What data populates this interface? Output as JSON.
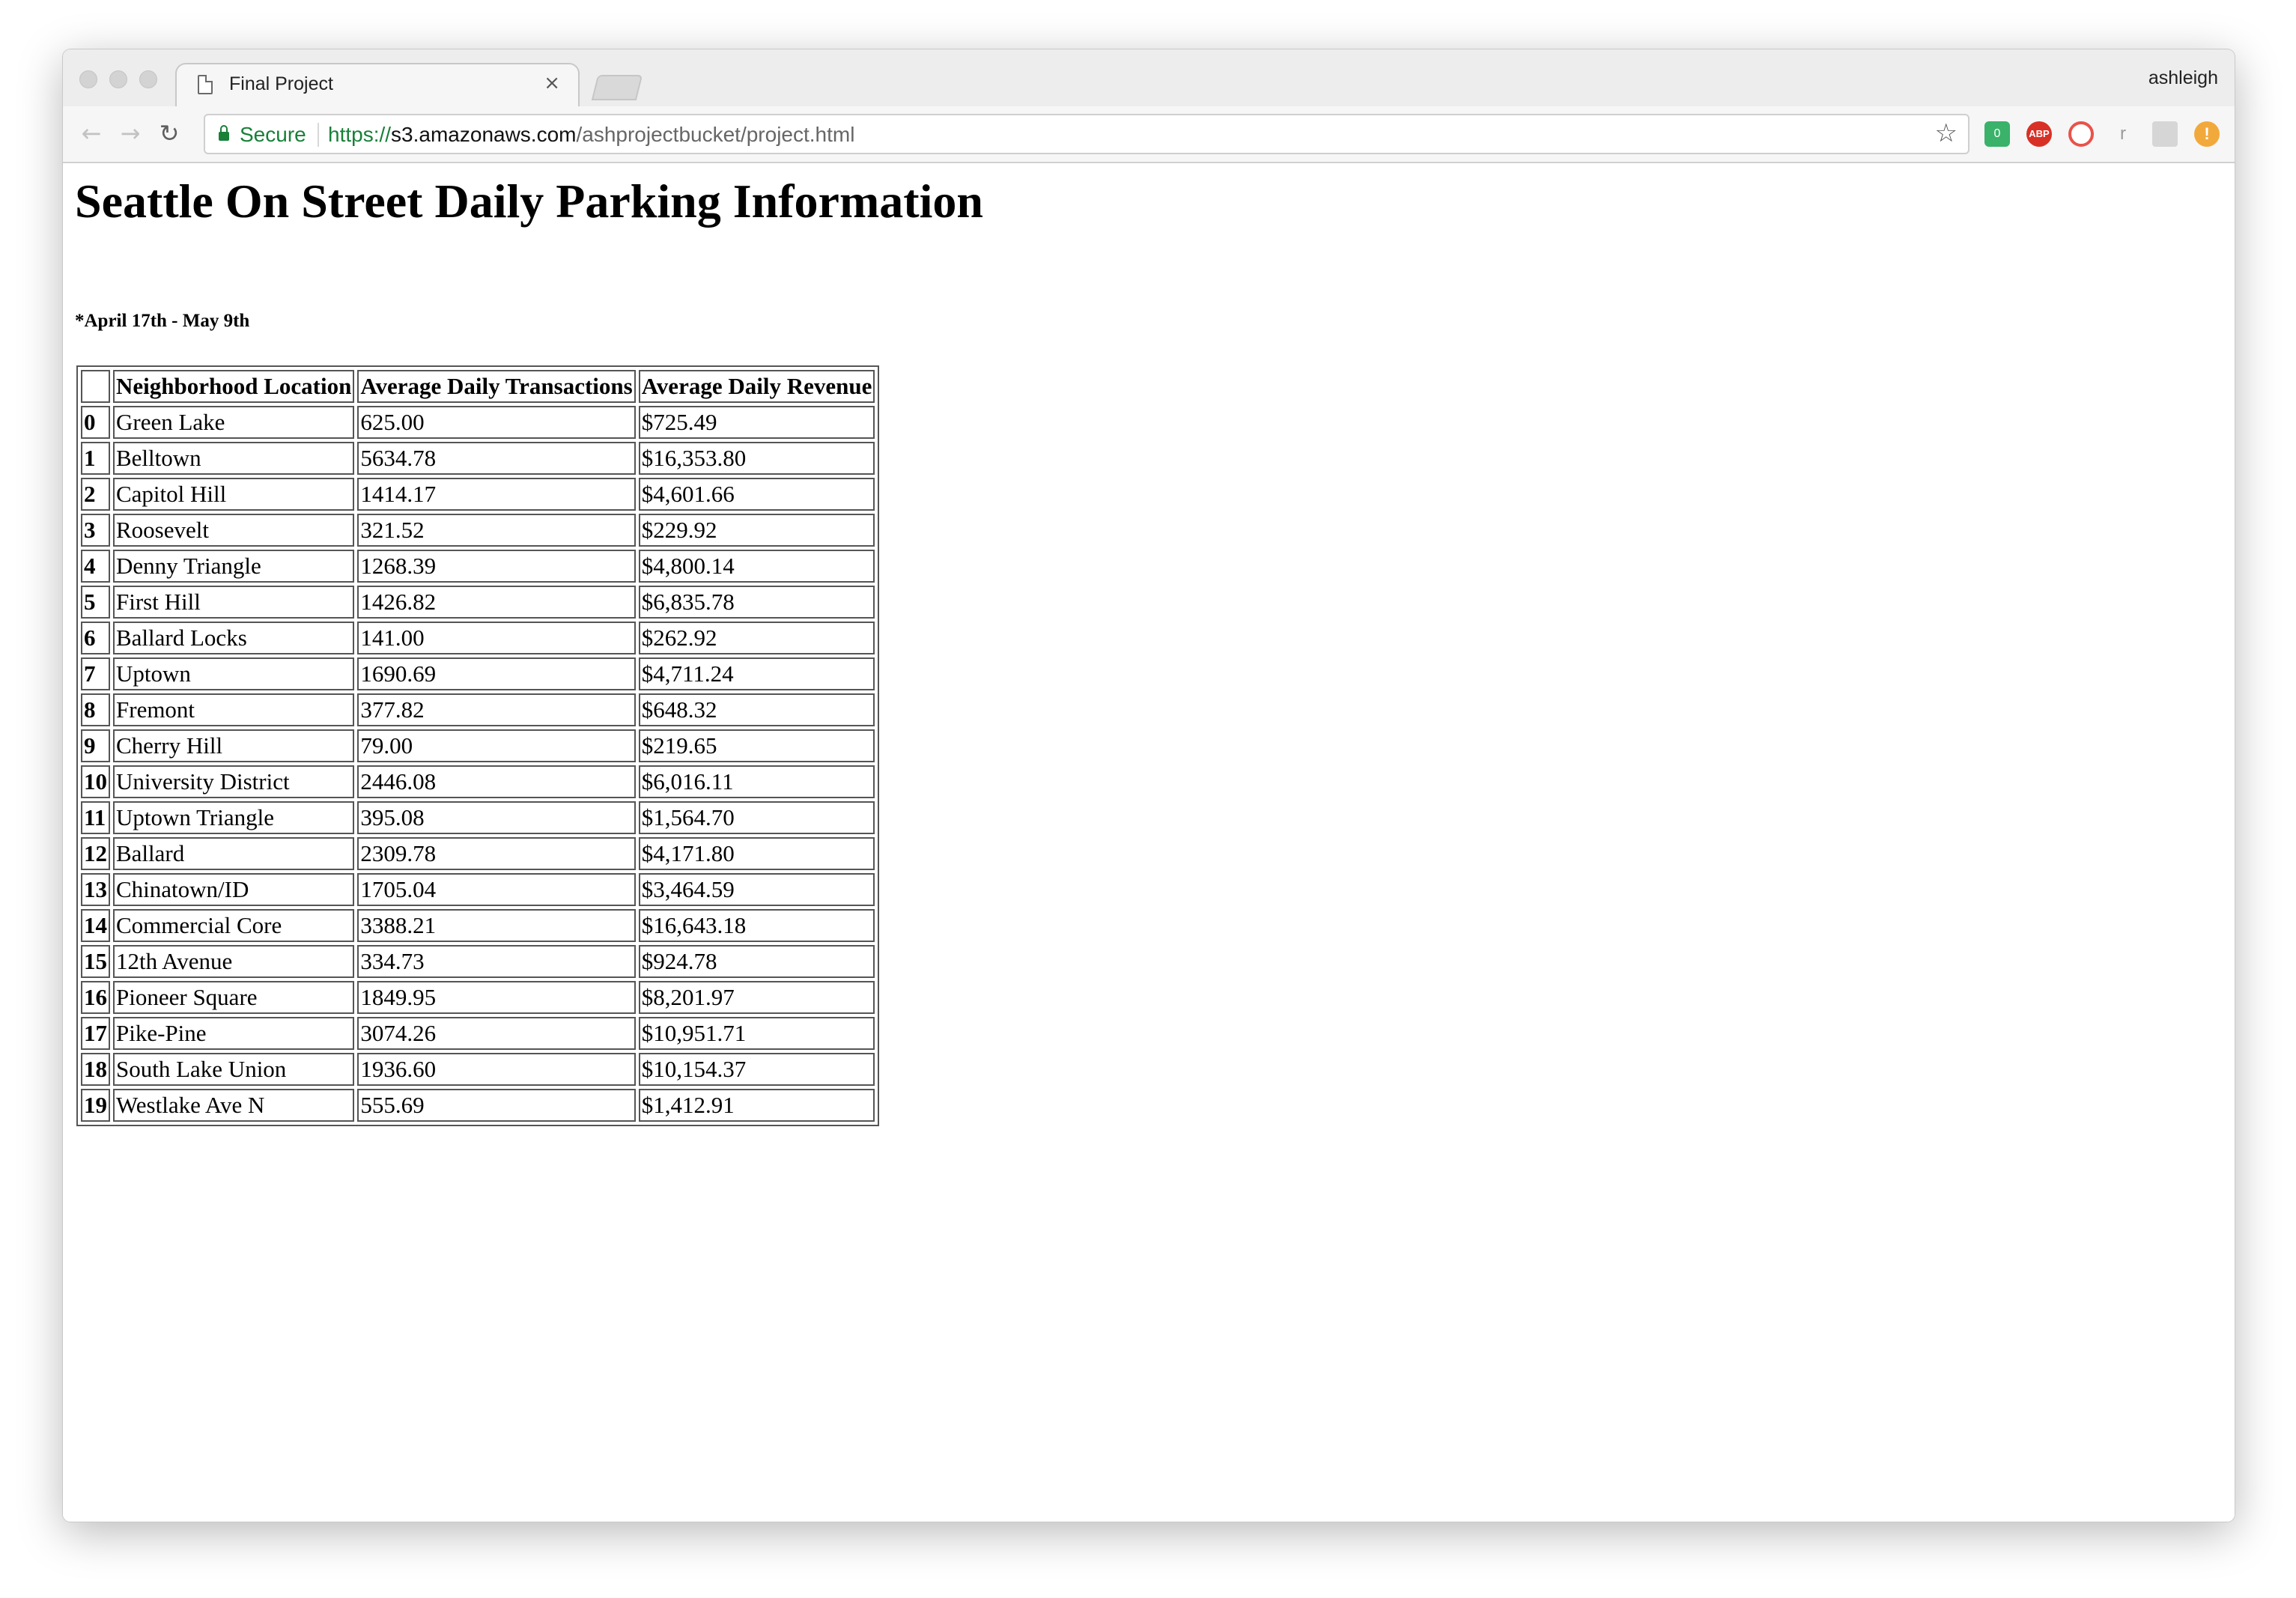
{
  "browser": {
    "tab_title": "Final Project",
    "tab_close": "×",
    "profile_name": "ashleigh",
    "secure_label": "Secure",
    "url_scheme": "https://",
    "url_host": "s3.amazonaws.com",
    "url_path": "/ashprojectbucket/project.html",
    "nav": {
      "back": "←",
      "forward": "→",
      "reload": "↻"
    },
    "star": "☆",
    "extensions": [
      {
        "name": "tampermonkey",
        "label": "0"
      },
      {
        "name": "adblock-plus",
        "label": "ABP"
      },
      {
        "name": "privacy",
        "label": ""
      },
      {
        "name": "r-extension",
        "label": "r"
      },
      {
        "name": "reader",
        "label": ""
      },
      {
        "name": "alert",
        "label": "!"
      }
    ],
    "colors": {
      "secure_green": "#188038",
      "abp_red": "#d93025",
      "alert_orange": "#f2a93b"
    }
  },
  "page": {
    "title": "Seattle On Street Daily Parking Information",
    "subtitle": "*April 17th - May 9th",
    "table": {
      "columns": [
        "",
        "Neighborhood Location",
        "Average Daily Transactions",
        "Average Daily Revenue"
      ],
      "rows": [
        [
          "0",
          "Green Lake",
          "625.00",
          "$725.49"
        ],
        [
          "1",
          "Belltown",
          "5634.78",
          "$16,353.80"
        ],
        [
          "2",
          "Capitol Hill",
          "1414.17",
          "$4,601.66"
        ],
        [
          "3",
          "Roosevelt",
          "321.52",
          "$229.92"
        ],
        [
          "4",
          "Denny Triangle",
          "1268.39",
          "$4,800.14"
        ],
        [
          "5",
          "First Hill",
          "1426.82",
          "$6,835.78"
        ],
        [
          "6",
          "Ballard Locks",
          "141.00",
          "$262.92"
        ],
        [
          "7",
          "Uptown",
          "1690.69",
          "$4,711.24"
        ],
        [
          "8",
          "Fremont",
          "377.82",
          "$648.32"
        ],
        [
          "9",
          "Cherry Hill",
          "79.00",
          "$219.65"
        ],
        [
          "10",
          "University District",
          "2446.08",
          "$6,016.11"
        ],
        [
          "11",
          "Uptown Triangle",
          "395.08",
          "$1,564.70"
        ],
        [
          "12",
          "Ballard",
          "2309.78",
          "$4,171.80"
        ],
        [
          "13",
          "Chinatown/ID",
          "1705.04",
          "$3,464.59"
        ],
        [
          "14",
          "Commercial Core",
          "3388.21",
          "$16,643.18"
        ],
        [
          "15",
          "12th Avenue",
          "334.73",
          "$924.78"
        ],
        [
          "16",
          "Pioneer Square",
          "1849.95",
          "$8,201.97"
        ],
        [
          "17",
          "Pike-Pine",
          "3074.26",
          "$10,951.71"
        ],
        [
          "18",
          "South Lake Union",
          "1936.60",
          "$10,154.37"
        ],
        [
          "19",
          "Westlake Ave N",
          "555.69",
          "$1,412.91"
        ]
      ]
    }
  }
}
